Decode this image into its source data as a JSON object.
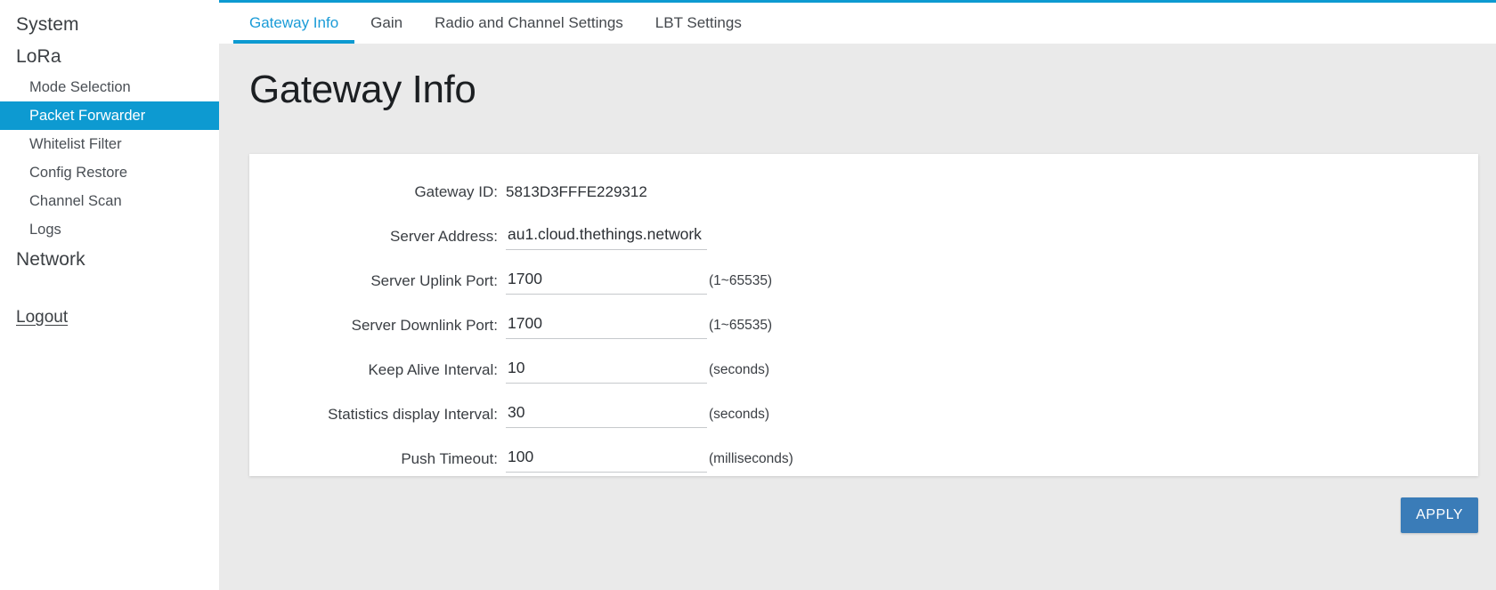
{
  "theme": {
    "accent": "#0d9ad1",
    "accent_tab_text": "#1a9bd7",
    "apply_button": "#3a7cb8",
    "content_bg": "#eaeaea",
    "card_bg": "#ffffff"
  },
  "sidebar": {
    "items": [
      {
        "label": "System",
        "level": "top",
        "active": false
      },
      {
        "label": "LoRa",
        "level": "top",
        "active": false
      },
      {
        "label": "Mode Selection",
        "level": "sub",
        "active": false
      },
      {
        "label": "Packet Forwarder",
        "level": "sub",
        "active": true
      },
      {
        "label": "Whitelist Filter",
        "level": "sub",
        "active": false
      },
      {
        "label": "Config Restore",
        "level": "sub",
        "active": false
      },
      {
        "label": "Channel Scan",
        "level": "sub",
        "active": false
      },
      {
        "label": "Logs",
        "level": "sub",
        "active": false
      },
      {
        "label": "Network",
        "level": "top",
        "active": false
      }
    ],
    "logout_label": "Logout"
  },
  "tabs": [
    {
      "label": "Gateway Info",
      "active": true
    },
    {
      "label": "Gain",
      "active": false
    },
    {
      "label": "Radio and Channel Settings",
      "active": false
    },
    {
      "label": "LBT Settings",
      "active": false
    }
  ],
  "page": {
    "title": "Gateway Info"
  },
  "form": {
    "rows": [
      {
        "label": "Gateway ID:",
        "type": "static",
        "value": "5813D3FFFE229312",
        "hint": "",
        "name": "gateway-id"
      },
      {
        "label": "Server Address:",
        "type": "input",
        "value": "au1.cloud.thethings.network",
        "hint": "",
        "name": "server-address"
      },
      {
        "label": "Server Uplink Port:",
        "type": "input",
        "value": "1700",
        "hint": "(1~65535)",
        "name": "server-uplink-port"
      },
      {
        "label": "Server Downlink Port:",
        "type": "input",
        "value": "1700",
        "hint": "(1~65535)",
        "name": "server-downlink-port"
      },
      {
        "label": "Keep Alive Interval:",
        "type": "input",
        "value": "10",
        "hint": "(seconds)",
        "name": "keep-alive-interval"
      },
      {
        "label": "Statistics display Interval:",
        "type": "input",
        "value": "30",
        "hint": "(seconds)",
        "name": "statistics-display-interval"
      },
      {
        "label": "Push Timeout:",
        "type": "input",
        "value": "100",
        "hint": "(milliseconds)",
        "name": "push-timeout"
      }
    ]
  },
  "actions": {
    "apply_label": "APPLY"
  }
}
